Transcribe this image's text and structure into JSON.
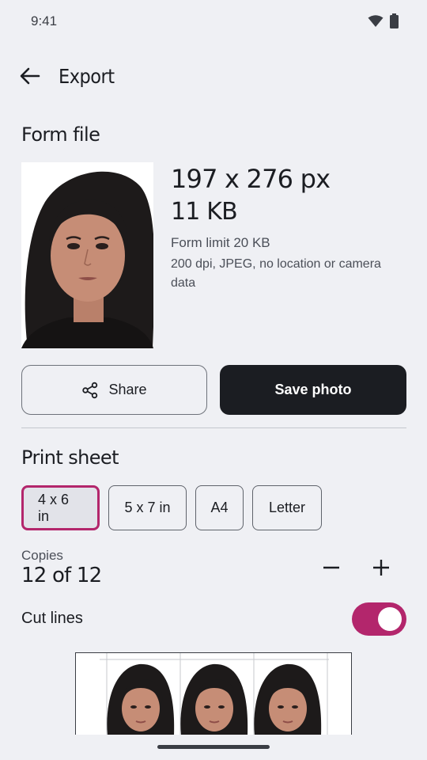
{
  "status_bar": {
    "time": "9:41",
    "icons": [
      "wifi-icon",
      "battery-icon"
    ]
  },
  "app_bar": {
    "title": "Export",
    "back_icon": "arrow-left-icon"
  },
  "form_file": {
    "section_title": "Form file",
    "dimensions": "197 x 276 px",
    "file_size": "11 KB",
    "limit": "Form limit 20 KB",
    "details": "200 dpi, JPEG, no location or camera data"
  },
  "actions": {
    "share_label": "Share",
    "share_icon": "share-icon",
    "save_label": "Save photo"
  },
  "print_sheet": {
    "section_title": "Print sheet",
    "sizes": [
      {
        "label": "4 x 6 in",
        "selected": true
      },
      {
        "label": "5 x 7 in",
        "selected": false
      },
      {
        "label": "A4",
        "selected": false
      },
      {
        "label": "Letter",
        "selected": false
      }
    ],
    "copies_label": "Copies",
    "copies_value": "12 of 12",
    "cut_lines_label": "Cut lines",
    "cut_lines_on": true
  },
  "colors": {
    "background": "#eff0f4",
    "accent": "#b3266c",
    "primary_button": "#1b1d22"
  }
}
